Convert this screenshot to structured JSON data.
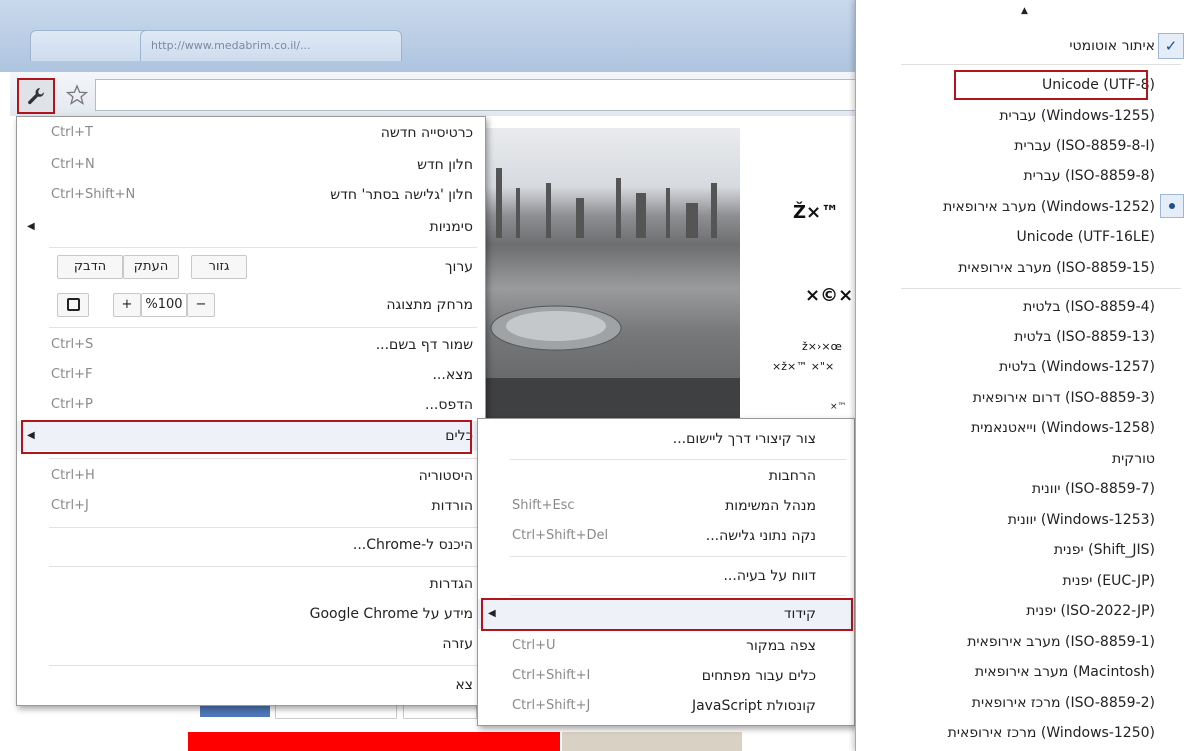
{
  "browser": {
    "tab_url": "http://www.medabrim.co.il/...",
    "garble": {
      "g1": "Ž×™",
      "g2": "×©×",
      "g3": "ž×›×œ",
      "g4": "×ž×™ ×\"×",
      "g5": "×™"
    }
  },
  "main_menu": {
    "new_tab": {
      "label": "כרטיסייה חדשה",
      "shortcut": "Ctrl+T"
    },
    "new_window": {
      "label": "חלון חדש",
      "shortcut": "Ctrl+N"
    },
    "new_incognito": {
      "label": "חלון 'גלישה בסתר' חדש",
      "shortcut": "Ctrl+Shift+N"
    },
    "bookmarks": {
      "label": "סימניות"
    },
    "edit": {
      "label": "ערוך",
      "cut": "גזור",
      "copy": "העתק",
      "paste": "הדבק"
    },
    "zoom": {
      "label": "מרחק מתצוגה",
      "minus": "−",
      "value": "%100",
      "plus": "+"
    },
    "save_page": {
      "label": "שמור דף בשם...",
      "shortcut": "Ctrl+S"
    },
    "find": {
      "label": "מצא...",
      "shortcut": "Ctrl+F"
    },
    "print": {
      "label": "הדפס...",
      "shortcut": "Ctrl+P"
    },
    "tools": {
      "label": "כלים"
    },
    "history": {
      "label": "היסטוריה",
      "shortcut": "Ctrl+H"
    },
    "downloads": {
      "label": "הורדות",
      "shortcut": "Ctrl+J"
    },
    "signin": {
      "label": "היכנס ל-Chrome..."
    },
    "settings": {
      "label": "הגדרות"
    },
    "about": {
      "label": "מידע על Google Chrome"
    },
    "help": {
      "label": "עזרה"
    },
    "exit": {
      "label": "צא"
    }
  },
  "tools_menu": {
    "create_shortcut": {
      "label": "צור קיצורי דרך ליישום..."
    },
    "extensions": {
      "label": "הרחבות"
    },
    "task_manager": {
      "label": "מנהל המשימות",
      "shortcut": "Shift+Esc"
    },
    "clear_data": {
      "label": "נקה נתוני גלישה...",
      "shortcut": "Ctrl+Shift+Del"
    },
    "report": {
      "label": "דווח על בעיה..."
    },
    "encoding": {
      "label": "קידוד"
    },
    "view_source": {
      "label": "צפה במקור",
      "shortcut": "Ctrl+U"
    },
    "dev_tools": {
      "label": "כלים עבור מפתחים",
      "shortcut": "Ctrl+Shift+I"
    },
    "js_console": {
      "label": "קונסולת JavaScript",
      "shortcut": "Ctrl+Shift+J"
    }
  },
  "encoding_menu": {
    "auto_detect": "איתור אוטומטי",
    "group1": [
      "Unicode (UTF-8)",
      "עברית (Windows-1255)",
      "עברית (ISO-8859-8-I)",
      "עברית (ISO-8859-8)",
      "מערב אירופאית (Windows-1252)",
      "Unicode (UTF-16LE)",
      "מערב אירופאית (ISO-8859-15)"
    ],
    "group2": [
      "בלטית (ISO-8859-4)",
      "בלטית (ISO-8859-13)",
      "בלטית (Windows-1257)",
      "דרום אירופאית (ISO-8859-3)",
      "וייאטנאמית (Windows-1258)",
      "טורקית",
      "יוונית (ISO-8859-7)",
      "יוונית (Windows-1253)",
      "יפנית (Shift_JIS)",
      "יפנית (EUC-JP)",
      "יפנית (ISO-2022-JP)",
      "מערב אירופאית (ISO-8859-1)",
      "מערב אירופאית (Macintosh)",
      "מרכז אירופאית (ISO-8859-2)",
      "מרכז אירופאית (Windows-1250)"
    ]
  }
}
